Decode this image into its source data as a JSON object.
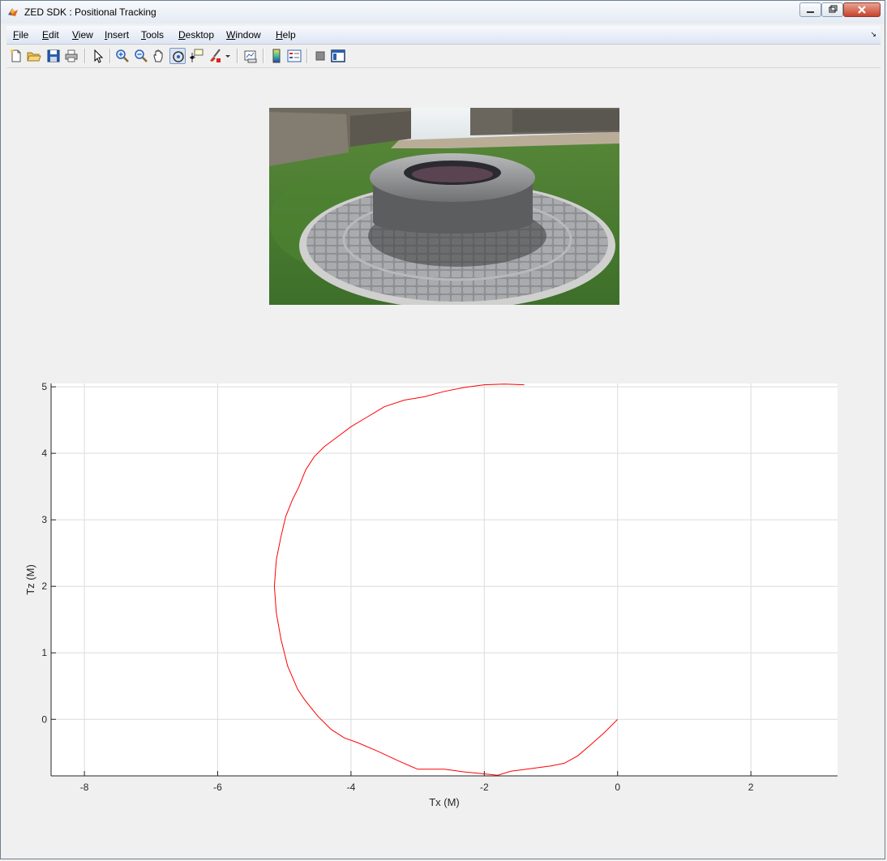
{
  "window": {
    "title": "ZED SDK : Positional Tracking",
    "app_icon": "matlab-icon"
  },
  "menu": {
    "items": [
      "File",
      "Edit",
      "View",
      "Insert",
      "Tools",
      "Desktop",
      "Window",
      "Help"
    ],
    "underline": [
      "F",
      "E",
      "V",
      "I",
      "T",
      "D",
      "W",
      "H"
    ],
    "rests": [
      "ile",
      "dit",
      "iew",
      "nsert",
      "ools",
      "esktop",
      "indow",
      "elp"
    ],
    "dock_arrow": "↘"
  },
  "toolbar": {
    "icons": [
      "new-figure-icon",
      "open-file-icon",
      "save-icon",
      "print-icon",
      "edit-plot-arrow-icon",
      "zoom-in-icon",
      "zoom-out-icon",
      "pan-hand-icon",
      "rotate-3d-icon",
      "data-cursor-icon",
      "brush-icon",
      "brush-dropdown-icon",
      "link-plot-icon",
      "colorbar-icon",
      "legend-icon",
      "hide-plot-tools-icon",
      "show-plot-tools-icon"
    ]
  },
  "image_panel": {
    "description_icon": "camera-frame-image"
  },
  "chart_data": {
    "type": "line",
    "xlabel": "Tx (M)",
    "ylabel": "Tz (M)",
    "xlim": [
      -8.5,
      3.3
    ],
    "ylim": [
      -0.85,
      5.05
    ],
    "xticks": [
      -8,
      -6,
      -4,
      -2,
      0,
      2
    ],
    "yticks": [
      0,
      1,
      2,
      3,
      4,
      5
    ],
    "grid": true,
    "series": [
      {
        "color": "#ff0000",
        "x": [
          0,
          -0.2,
          -0.4,
          -0.6,
          -0.8,
          -1.0,
          -1.3,
          -1.6,
          -1.8,
          -2.0,
          -2.3,
          -2.6,
          -3.0,
          -3.3,
          -3.6,
          -3.9,
          -4.1,
          -4.3,
          -4.5,
          -4.7,
          -4.8,
          -4.95,
          -5.05,
          -5.12,
          -5.15,
          -5.12,
          -5.05,
          -4.98,
          -4.88,
          -4.78,
          -4.68,
          -4.55,
          -4.4,
          -4.2,
          -4.0,
          -3.75,
          -3.5,
          -3.2,
          -2.9,
          -2.6,
          -2.3,
          -2.0,
          -1.7,
          -1.4
        ],
        "y": [
          0,
          -0.2,
          -0.38,
          -0.55,
          -0.66,
          -0.7,
          -0.74,
          -0.78,
          -0.84,
          -0.82,
          -0.79,
          -0.75,
          -0.75,
          -0.62,
          -0.48,
          -0.35,
          -0.28,
          -0.15,
          0.05,
          0.3,
          0.45,
          0.8,
          1.2,
          1.6,
          2.0,
          2.4,
          2.75,
          3.05,
          3.3,
          3.5,
          3.75,
          3.95,
          4.1,
          4.25,
          4.4,
          4.55,
          4.7,
          4.8,
          4.85,
          4.93,
          4.99,
          5.03,
          5.04,
          5.03
        ]
      }
    ]
  }
}
